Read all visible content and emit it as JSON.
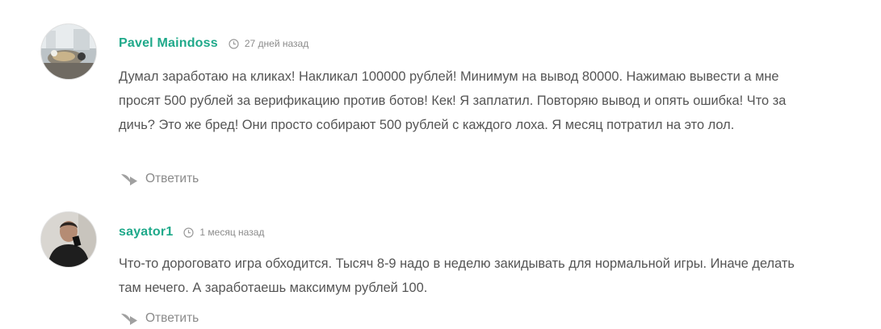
{
  "comments": [
    {
      "author": "Pavel Maindoss",
      "time": "27 дней назад",
      "text": "Думал заработаю на кликах! Накликал 100000 рублей! Минимум на вывод 80000. Нажимаю вывести а мне просят 500 рублей за верификацию против ботов! Кек! Я заплатил. Повторяю вывод и опять ошибка! Что за дичь? Это же бред! Они просто собирают 500 рублей с каждого лоха. Я месяц потратил на это лол.",
      "reply_label": "Ответить",
      "avatar_icon": "user-photo-avatar",
      "time_icon": "clock-icon",
      "reply_icon": "reply-arrow-icon"
    },
    {
      "author": "sayator1",
      "time": "1 месяц назад",
      "text": "Что-то дороговато игра обходится. Тысяч 8-9 надо в неделю закидывать для нормальной игры. Иначе делать там нечего. А заработаешь максимум рублей 100.",
      "reply_label": "Ответить",
      "avatar_icon": "user-photo-avatar",
      "time_icon": "clock-icon",
      "reply_icon": "reply-arrow-icon"
    }
  ],
  "colors": {
    "author": "#1fa98a",
    "text": "#555555",
    "meta": "#8b8b8b",
    "icon": "#9a9a9a"
  }
}
